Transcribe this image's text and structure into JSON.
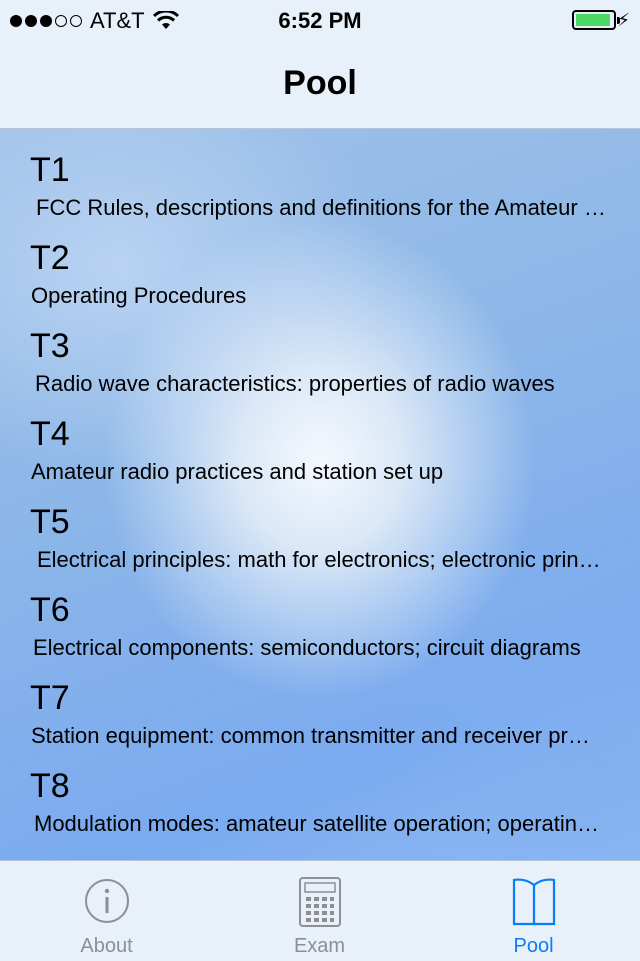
{
  "status": {
    "carrier": "AT&T",
    "time": "6:52 PM",
    "signal_filled": 3,
    "signal_total": 5,
    "battery_level": 0.95,
    "icons": [
      "wifi-icon",
      "battery-icon",
      "charging-bolt-icon"
    ]
  },
  "nav": {
    "title": "Pool"
  },
  "topics": [
    {
      "code": "T1",
      "description": "FCC Rules, descriptions and definitions for the Amateur Radio Service"
    },
    {
      "code": "T2",
      "description": "Operating Procedures"
    },
    {
      "code": "T3",
      "description": "Radio wave characteristics: properties of radio waves"
    },
    {
      "code": "T4",
      "description": "Amateur radio practices and station set up"
    },
    {
      "code": "T5",
      "description": "Electrical principles: math for electronics; electronic principles"
    },
    {
      "code": "T6",
      "description": "Electrical components: semiconductors; circuit diagrams"
    },
    {
      "code": "T7",
      "description": "Station equipment: common transmitter and receiver problems"
    },
    {
      "code": "T8",
      "description": "Modulation modes: amateur satellite operation; operating activities"
    }
  ],
  "tabs": [
    {
      "label": "About",
      "icon": "info-icon",
      "active": false
    },
    {
      "label": "Exam",
      "icon": "calculator-icon",
      "active": false
    },
    {
      "label": "Pool",
      "icon": "book-icon",
      "active": true
    }
  ],
  "colors": {
    "accent": "#0a7ef7",
    "inactive": "#8e8e93",
    "battery": "#4cd964"
  }
}
